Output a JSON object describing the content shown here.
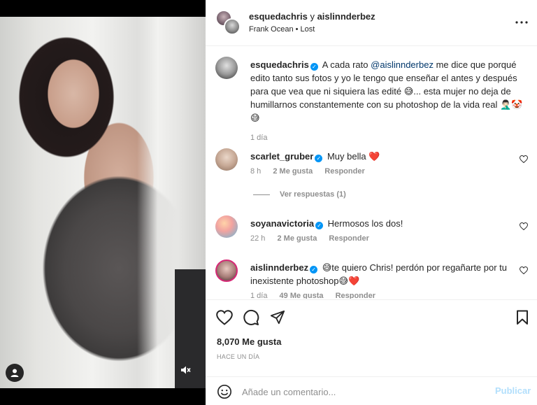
{
  "header": {
    "user1": "esquedachris",
    "conjunction": "y",
    "user2": "aislinnderbez",
    "audio": "Frank Ocean • Lost",
    "more_icon": "more-horizontal-icon"
  },
  "caption": {
    "user": "esquedachris",
    "text_before_mention": "A cada rato",
    "mention": "@aislinnderbez",
    "text_after_mention": "me dice que porqué edito tanto sus fotos y yo le tengo que enseñar el antes y después para que vea que ni siquiera las edité 😅... esta mujer no deja de humillarnos constantemente con su photoshop de la vida real 🤦🏻‍♂️🤡😅",
    "time": "1 día"
  },
  "comments": [
    {
      "user": "scarlet_gruber",
      "text": "Muy bella ❤️",
      "time": "8 h",
      "likes": "2 Me gusta",
      "reply": "Responder"
    },
    {
      "user": "soyanavictoria",
      "text": "Hermosos los dos!",
      "time": "22 h",
      "likes": "2 Me gusta",
      "reply": "Responder"
    },
    {
      "user": "aislinnderbez",
      "text": "😅te quiero Chris! perdón por regañarte por tu inexistente photoshop😅❤️",
      "time": "1 día",
      "likes": "49 Me gusta",
      "reply": "Responder"
    }
  ],
  "view_replies": "Ver respuestas (1)",
  "likes_count": "8,070 Me gusta",
  "posted_ago": "HACE UN DÍA",
  "composer": {
    "placeholder": "Añade un comentario...",
    "post_label": "Publicar"
  },
  "colors": {
    "link": "#00376b",
    "verified": "#0095f6",
    "muted": "#8e8e8e",
    "publish_disabled": "#b2dffc",
    "heart": "#ed4956"
  }
}
